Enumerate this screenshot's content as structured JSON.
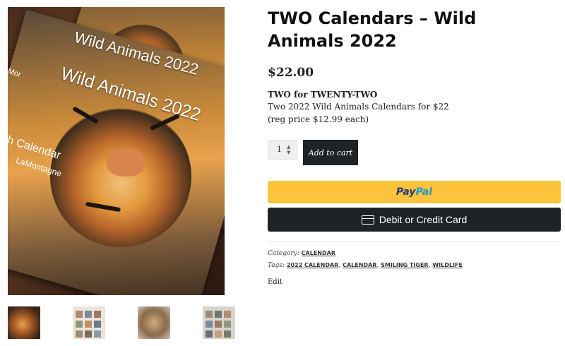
{
  "product": {
    "title": "TWO Calendars – Wild Animals 2022",
    "price": "$22.00",
    "desc_line1": "TWO for TWENTY-TWO",
    "desc_line2": "Two 2022 Wild Animals Calendars for $22",
    "desc_line3": "(reg price $12.99 each)"
  },
  "image": {
    "calendar_title_back": "Wild Animals 2022",
    "calendar_title_front": "Wild Animals 2022",
    "calendar_sub1": "h Calendar",
    "calendar_sub2": "LaMontagne",
    "calendar_side_text": "Mor"
  },
  "cart": {
    "quantity": "1",
    "add_to_cart_label": "Add to cart"
  },
  "payment": {
    "paypal_part1": "Pay",
    "paypal_part2": "Pal",
    "debit_label": "Debit or Credit Card",
    "paypal_color": "#fec33a",
    "debit_color": "#1f2227"
  },
  "meta": {
    "category_label": "Category:",
    "category": "CALENDAR",
    "tags_label": "Tags:",
    "tags": [
      "2022 CALENDAR",
      "CALENDAR",
      "SMILING TIGER",
      "WILDLIFE"
    ],
    "edit_label": "Edit"
  }
}
